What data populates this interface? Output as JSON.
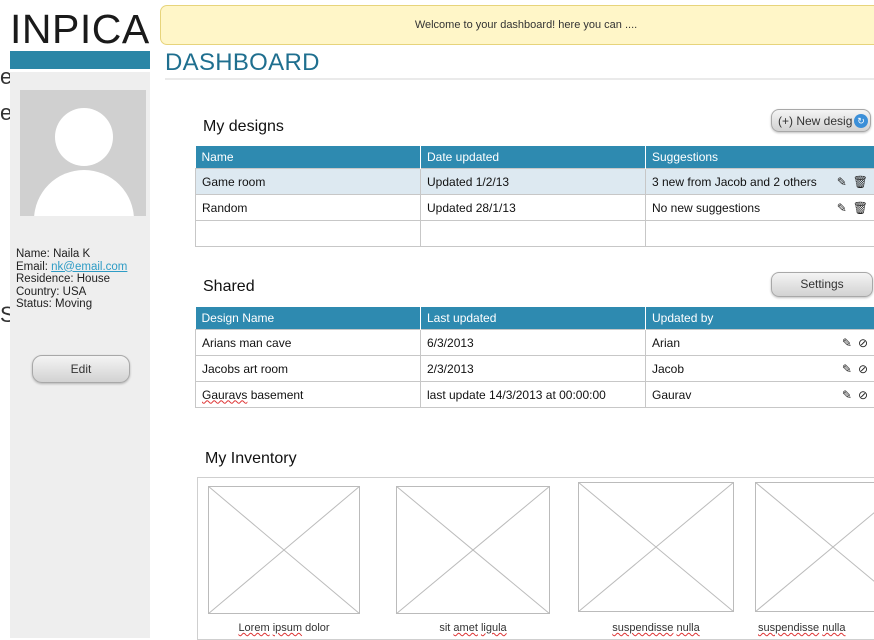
{
  "brand": {
    "logo": "INPICA"
  },
  "stray": {
    "top": "e",
    "middle": "e",
    "bottom": "S"
  },
  "welcome": {
    "text": "Welcome to your dashboard! here you can ...."
  },
  "page": {
    "title": "DASHBOARD"
  },
  "profile": {
    "name_label": "Name:",
    "name": "Naila K",
    "email_label": "Email:",
    "email": "nk@email.com",
    "residence_label": "Residence:",
    "residence": "House",
    "country_label": "Country:",
    "country": "USA",
    "status_label": "Status:",
    "status": "Moving",
    "edit_label": "Edit"
  },
  "my_designs": {
    "title": "My designs",
    "new_button": "(+) New desig",
    "columns": [
      "Name",
      "Date updated",
      "Suggestions"
    ],
    "rows": [
      {
        "name": "Game room",
        "date": "Updated 1/2/13",
        "suggestions": "3 new from Jacob and 2 others"
      },
      {
        "name": "Random",
        "date": "Updated 28/1/13",
        "suggestions": "No new suggestions"
      }
    ]
  },
  "shared": {
    "title": "Shared",
    "settings_button": "Settings",
    "columns": [
      "Design Name",
      "Last updated",
      "Updated by"
    ],
    "rows": [
      {
        "name": "Arians man cave",
        "date": "6/3/2013",
        "by": "Arian"
      },
      {
        "name": "Jacobs art room",
        "date": "2/3/2013",
        "by": "Jacob"
      },
      {
        "name": "Gauravs",
        "name_rest": " basement",
        "date": "last update 14/3/2013 at 00:00:00",
        "by": "Gaurav"
      }
    ]
  },
  "inventory": {
    "title": "My Inventory",
    "items": [
      {
        "w1": "Lorem",
        "w2": "ipsum",
        "w3": "dolor"
      },
      {
        "w1": "sit",
        "w2": "amet",
        "w3": "ligula"
      },
      {
        "w1": "suspendisse",
        "w2": "nulla",
        "w3": ""
      },
      {
        "w1": "suspendisse",
        "w2": "nulla",
        "w3": ""
      }
    ]
  },
  "icons": {
    "edit": "edit-icon",
    "delete": "trash-icon",
    "hide": "eye-slash-icon",
    "cursor": "cursor-icon"
  }
}
